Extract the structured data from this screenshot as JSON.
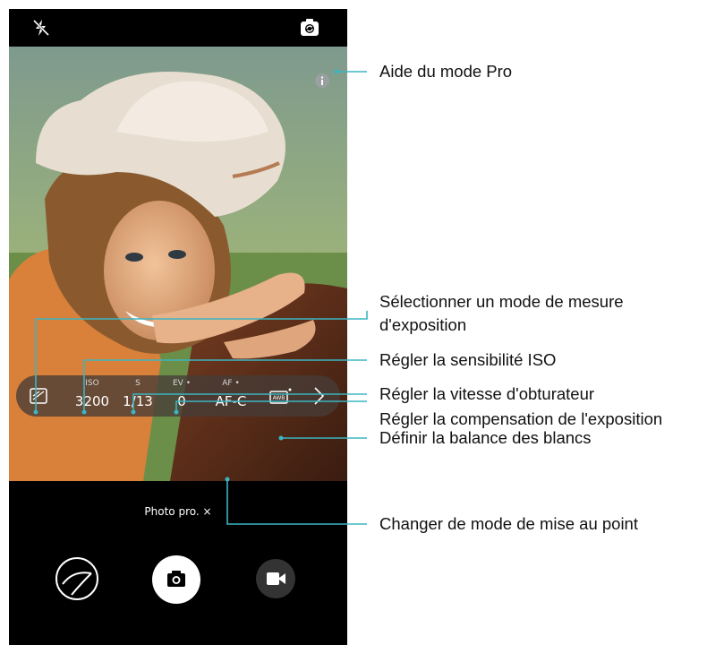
{
  "camera": {
    "mode_label": "Photo pro. ×",
    "pro_controls": [
      {
        "id": "metering",
        "label": "",
        "value": ""
      },
      {
        "id": "iso",
        "label": "ISO",
        "value": "3200"
      },
      {
        "id": "shutter",
        "label": "S",
        "value": "1/13"
      },
      {
        "id": "ev",
        "label": "EV",
        "value": "0"
      },
      {
        "id": "af",
        "label": "AF",
        "value": "AF-C"
      },
      {
        "id": "wb",
        "label": "",
        "value": "AWB"
      }
    ],
    "icons": [
      "flash-off-icon",
      "switch-camera-icon",
      "info-icon",
      "metering-icon",
      "white-balance-icon",
      "chevron-right-icon",
      "gallery-icon",
      "shutter-icon",
      "video-icon"
    ],
    "accent_color": "#3bb5c2"
  },
  "callouts": {
    "pro_help": "Aide du mode Pro",
    "metering_line1": "Sélectionner un mode de mesure",
    "metering_line2": "d'exposition",
    "iso": "Régler la sensibilité ISO",
    "shutter": "Régler la vitesse d'obturateur",
    "ev": "Régler la compensation de l'exposition",
    "wb": "Définir la balance des blancs",
    "af": "Changer de mode de mise au point"
  }
}
